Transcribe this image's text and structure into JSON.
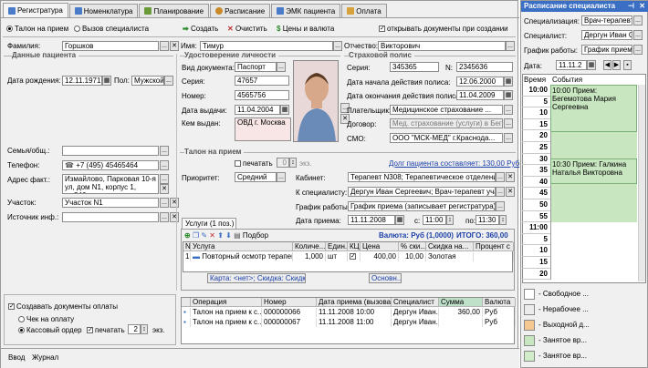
{
  "tabs": [
    {
      "label": "Регистратура",
      "icon_color": "#4a7bc8"
    },
    {
      "label": "Номенклатура",
      "icon_color": "#4a7bc8"
    },
    {
      "label": "Планирование",
      "icon_color": "#6a9a3a"
    },
    {
      "label": "Расписание",
      "icon_color": "#c88a2a"
    },
    {
      "label": "ЭМК пациента",
      "icon_color": "#4a7bc8"
    },
    {
      "label": "Оплата",
      "icon_color": "#d6a23a"
    }
  ],
  "toolbar": {
    "talon": "Талон на прием",
    "call": "Вызов специалиста",
    "create": "Создать",
    "clear": "Очистить",
    "prices": "Цены и валюта",
    "open_docs": "открывать документы при создании"
  },
  "patient": {
    "surname_label": "Фамилия:",
    "surname": "Горшков",
    "name_label": "Имя:",
    "name": "Тимур",
    "patronymic_label": "Отчество:",
    "patronymic": "Викторович",
    "section": "Данные пациента",
    "birth_label": "Дата рождения:",
    "birth": "12.11.1971",
    "sex_label": "Пол:",
    "sex": "Мужской",
    "family_label": "Семья/общ.:",
    "phone_label": "Телефон:",
    "phone": "+7 (495) 45465464",
    "address_label": "Адрес факт.:",
    "address1": "Измайлово, Парковая 10-я",
    "address2": "ул, дом N1, корпус 1, кв.346",
    "area_label": "Участок:",
    "area": "Участок N1",
    "source_label": "Источник инф.:"
  },
  "id_card": {
    "section": "Удостоверение личности",
    "doc_label": "Вид документа:",
    "doc": "Паспорт",
    "series_label": "Серия:",
    "series": "47657",
    "number_label": "Номер:",
    "number": "4565756",
    "issued_label": "Дата выдачи:",
    "issued": "11.04.2004",
    "by_label": "Кем выдан:",
    "by": "ОВД г. Москва"
  },
  "insurance": {
    "section": "Страховой полис",
    "series_label": "Серия:",
    "series": "345365",
    "num_label": "N:",
    "num": "2345636",
    "start_label": "Дата начала действия полиса:",
    "start": "12.06.2000",
    "end_label": "Дата окончания действия полиса:",
    "end": "11.04.2009",
    "payer_label": "Плательщик:",
    "payer": "Медицинское страхование ...",
    "contract_label": "Договор:",
    "contract": "Мед. страхование (услуги) в Беге...",
    "smo_label": "СМО:",
    "smo": "ООО \"МСК-МЕД\" г.Краснода..."
  },
  "appointment": {
    "section": "Талон на прием",
    "print": "печатать",
    "copies": "0",
    "copies_unit": "экз.",
    "debt_link": "Долг пациента составляет: 130,00 Руб",
    "priority_label": "Приоритет:",
    "priority": "Средний",
    "cabinet_label": "Кабинет:",
    "cabinet": "Терапевт N308; Терапевтическое отделение",
    "spec_label": "К специалисту:",
    "spec": "Дергун Иван Сергеевич; Врач-терапевт участ...",
    "schedule_label": "График работы:",
    "schedule": "График приема (записывает регистратура)",
    "date_label": "Дата приема:",
    "date": "11.11.2008",
    "from_label": "с:",
    "from": "11:00",
    "to_label": "по:",
    "to": "11:30"
  },
  "services": {
    "tab": "Услуги (1 поз.)",
    "selection": "Подбор",
    "currency": "Валюта: Руб (1,0000)",
    "total": "ИТОГО: 360,00",
    "columns": [
      "N",
      "Услуга",
      "Количе...",
      "Един...",
      "КЦ",
      "Цена",
      "% ски...",
      "Скидка на...",
      "Процент с"
    ],
    "rows": [
      [
        "1",
        "Повторный осмотр терапевта",
        "1,000",
        "шт",
        "",
        "400,00",
        "10,00",
        "Золотая",
        ""
      ]
    ],
    "footer_card": "Карта: <нет>; Скидка: Скидк...",
    "footer_main": "Основн..."
  },
  "payment": {
    "create": "Создавать документы оплаты",
    "check": "Чек на оплату",
    "cash": "Кассовый ордер",
    "print": "печатать",
    "copies": "2",
    "copies_unit": "экз."
  },
  "ops": {
    "columns": [
      "Операция",
      "Номер",
      "Дата приема (вызова)",
      "Специалист",
      "Сумма",
      "Валюта"
    ],
    "rows": [
      [
        "Талон на прием к с...",
        "000000066",
        "11.11.2008 10:00",
        "Дергун Иван...",
        "360,00",
        "Руб"
      ],
      [
        "Талон на прием к с...",
        "000000067",
        "11.11.2008 11:00",
        "Дергун Иван...",
        "",
        "Руб"
      ]
    ]
  },
  "status": {
    "input": "Ввод",
    "journal": "Журнал"
  },
  "schedule_panel": {
    "title": "Расписание специалиста",
    "spec_label": "Специализация:",
    "spec": "Врач-терапевт ...",
    "doctor_label": "Специалист:",
    "doctor": "Дергун Иван Се...",
    "graph_label": "График работы:",
    "graph": "График приема ...",
    "date_label": "Дата:",
    "date": "11.11.2",
    "col_time": "Время",
    "col_event": "События",
    "slots": [
      {
        "t": "10:00",
        "state": "busy"
      },
      {
        "t": "5",
        "state": "busy"
      },
      {
        "t": "10",
        "state": "busy"
      },
      {
        "t": "15",
        "state": "busy"
      },
      {
        "t": "20",
        "state": "busy"
      },
      {
        "t": "25",
        "state": "busy"
      },
      {
        "t": "30",
        "state": "busy"
      },
      {
        "t": "35",
        "state": "busy"
      },
      {
        "t": "40",
        "state": "busy"
      },
      {
        "t": "45",
        "state": "busy"
      },
      {
        "t": "50",
        "state": "busy"
      },
      {
        "t": "55",
        "state": "busy"
      },
      {
        "t": "11:00",
        "state": "free"
      },
      {
        "t": "5",
        "state": "free"
      },
      {
        "t": "10",
        "state": "free"
      },
      {
        "t": "15",
        "state": "free"
      },
      {
        "t": "20",
        "state": "free"
      }
    ],
    "event1": "10:00 Прием: Бегемотова Мария Сергеевна",
    "event2": "10:30 Прием: Галкина Наталья Викторовна",
    "legend": [
      {
        "label": "- Свободное ...",
        "color": "#ffffff"
      },
      {
        "label": "- Нерабочее ...",
        "color": "#ececec"
      },
      {
        "label": "- Выходной д...",
        "color": "#f4c890"
      },
      {
        "label": "- Занятое вр...",
        "color": "#c8e6c0"
      },
      {
        "label": "- Занятое вр...",
        "color": "#d0ecc8"
      }
    ]
  }
}
